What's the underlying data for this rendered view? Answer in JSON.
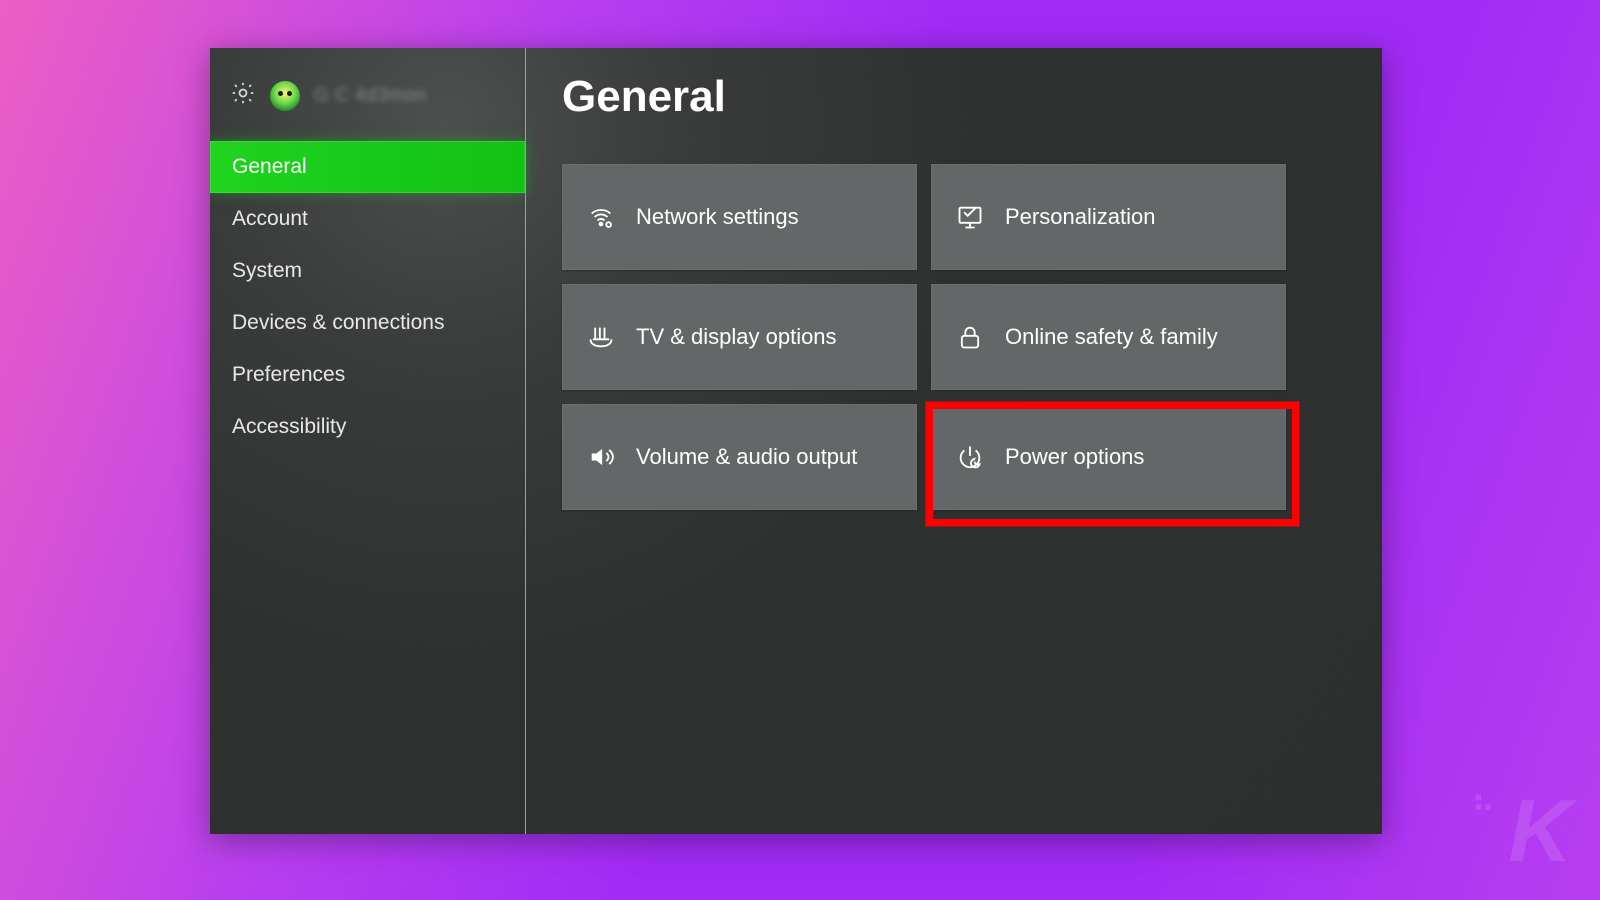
{
  "header": {
    "gamertag_blurred": "G C 4d3mon"
  },
  "sidebar": {
    "items": [
      {
        "label": "General",
        "selected": true
      },
      {
        "label": "Account",
        "selected": false
      },
      {
        "label": "System",
        "selected": false
      },
      {
        "label": "Devices & connections",
        "selected": false
      },
      {
        "label": "Preferences",
        "selected": false
      },
      {
        "label": "Accessibility",
        "selected": false
      }
    ]
  },
  "main": {
    "title": "General",
    "tiles": [
      {
        "label": "Network settings",
        "icon": "network-icon"
      },
      {
        "label": "Personalization",
        "icon": "personalization-icon"
      },
      {
        "label": "TV & display options",
        "icon": "tv-display-icon"
      },
      {
        "label": "Online safety & family",
        "icon": "lock-icon"
      },
      {
        "label": "Volume & audio output",
        "icon": "volume-icon"
      },
      {
        "label": "Power options",
        "icon": "power-icon",
        "highlighted": true
      }
    ]
  },
  "watermark": "K"
}
